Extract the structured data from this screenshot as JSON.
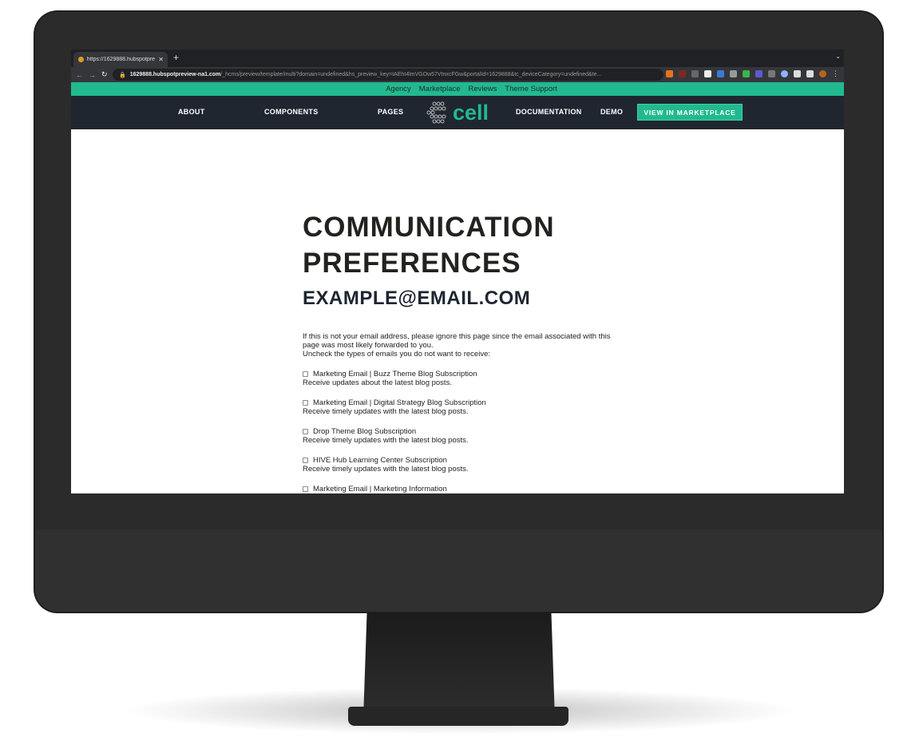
{
  "browser": {
    "tab_title": "https://1629888.hubspotprevi...",
    "url_host": "1629888.hubspotpreview-na1.com",
    "url_path": "/_hcms/preview/template/multi?domain=undefined&hs_preview_key=IAEhI4lmVGOw57VtnxcFGw&portalId=1629888&tc_deviceCategory=undefined&te..."
  },
  "topbar": {
    "links": [
      "Agency",
      "Marketplace",
      "Reviews",
      "Theme Support"
    ]
  },
  "nav": {
    "about": "ABOUT",
    "components": "COMPONENTS",
    "pages": "PAGES",
    "logo": "cell",
    "documentation": "DOCUMENTATION",
    "demo": "DEMO",
    "cta": "VIEW IN MARKETPLACE"
  },
  "colors": {
    "accent": "#22b98f",
    "nav_bg": "#1f2630"
  },
  "page": {
    "title": "COMMUNICATION PREFERENCES",
    "email": "EXAMPLE@EMAIL.COM",
    "intro1": "If this is not your email address, please ignore this page since the email associated with this page was most likely forwarded to you.",
    "intro2": "Uncheck the types of emails you do not want to receive:",
    "subscriptions": [
      {
        "name": "Marketing Email | Buzz Theme Blog Subscription",
        "desc": "Receive updates about the latest blog posts.",
        "checked": false
      },
      {
        "name": "Marketing Email | Digital Strategy Blog Subscription",
        "desc": "Receive timely updates with the latest blog posts.",
        "checked": false
      },
      {
        "name": "Drop Theme Blog Subscription",
        "desc": "Receive timely updates with the latest blog posts.",
        "checked": false
      },
      {
        "name": "HIVE Hub Learning Center Subscription",
        "desc": "Receive timely updates with the latest blog posts.",
        "checked": false
      },
      {
        "name": "Marketing Email | Marketing Information",
        "desc": "",
        "checked": false
      }
    ]
  }
}
